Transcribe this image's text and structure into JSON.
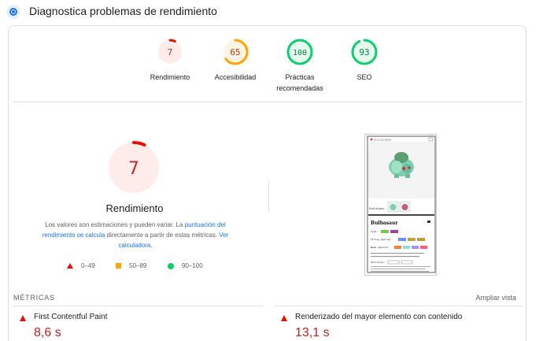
{
  "header": {
    "title": "Diagnostica problemas de rendimiento"
  },
  "scores": [
    {
      "value": "7",
      "label": "Rendimiento",
      "color": "#eb0f00",
      "bg": "#fdecea",
      "percent": 7
    },
    {
      "value": "65",
      "label": "Accesibilidad",
      "color": "#ffa400",
      "bg": "#fff4e5",
      "percent": 65
    },
    {
      "value": "100",
      "label": "Prácticas",
      "label2": "recomendadas",
      "color": "#0cce6b",
      "bg": "#e6f9ee",
      "percent": 100
    },
    {
      "value": "93",
      "label": "SEO",
      "color": "#0cce6b",
      "bg": "#e6f9ee",
      "percent": 93
    }
  ],
  "main": {
    "score": "7",
    "percent": 7,
    "title": "Rendimiento",
    "desc_1": "Los valores son estimaciones y pueden variar. La ",
    "desc_link_1": "puntuación del rendimiento se calcula",
    "desc_2": " directamente a partir de estas métricas. ",
    "desc_link_2": "Ver calculadora."
  },
  "legend": [
    {
      "range": "0–49"
    },
    {
      "range": "50–89"
    },
    {
      "range": "90–100"
    }
  ],
  "screenshot": {
    "app_name": "GLUCOSORIDO",
    "evolutions_label": "Evolutions:",
    "pokemon_name": "Bulbasaur",
    "type_label": "Type:",
    "strong_label": "Strong against:",
    "weak_label": "Weak against:",
    "abilities_label": "Abilities:"
  },
  "metrics": {
    "label": "MÉTRICAS",
    "expand": "Ampliar vista",
    "items": [
      {
        "name": "First Contentful Paint",
        "value": "8,6 s"
      },
      {
        "name": "Renderizado del mayor elemento con contenido",
        "value": "13,1 s"
      }
    ]
  }
}
